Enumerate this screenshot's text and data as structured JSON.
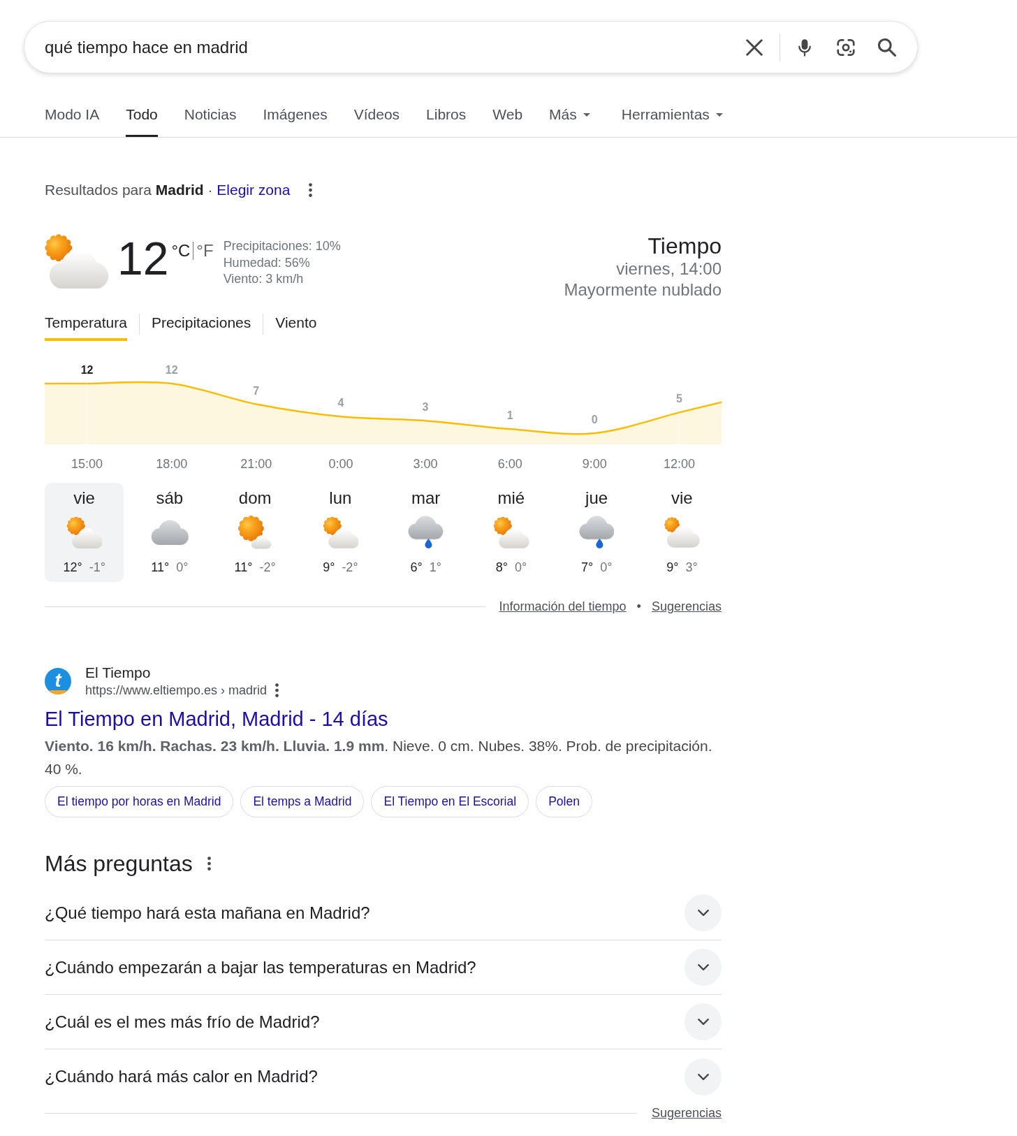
{
  "search": {
    "value": "qué tiempo hace en madrid"
  },
  "tabs": [
    {
      "label": "Modo IA",
      "kind": "link",
      "selected": false
    },
    {
      "label": "Todo",
      "kind": "link",
      "selected": true
    },
    {
      "label": "Noticias",
      "kind": "link",
      "selected": false
    },
    {
      "label": "Imágenes",
      "kind": "link",
      "selected": false
    },
    {
      "label": "Vídeos",
      "kind": "link",
      "selected": false
    },
    {
      "label": "Libros",
      "kind": "link",
      "selected": false
    },
    {
      "label": "Web",
      "kind": "link",
      "selected": false
    },
    {
      "label": "Más",
      "kind": "menu",
      "selected": false
    },
    {
      "label": "Herramientas",
      "kind": "tools",
      "selected": false
    }
  ],
  "location": {
    "text": "Resultados para **Madrid** ·",
    "link": "Elegir zona"
  },
  "weather": {
    "icon": {
      "kind": "mostly_cloudy"
    },
    "temperature": "12",
    "units": [
      {
        "label": "°C",
        "selected": true
      },
      {
        "label": "°F",
        "selected": false
      }
    ],
    "details": [
      "Precipitaciones: 10%",
      "Humedad: 56%",
      "Viento: 3 km/h"
    ],
    "title": "Tiempo",
    "datetime": "viernes, 14:00",
    "description": "Mayormente nublado",
    "chart_tabs": [
      {
        "label": "Temperatura",
        "selected": true
      },
      {
        "label": "Precipitaciones",
        "selected": false
      },
      {
        "label": "Viento",
        "selected": false
      }
    ],
    "chart": {
      "chart_data": {
        "type": "area",
        "categories": [
          "15:00",
          "18:00",
          "21:00",
          "0:00",
          "3:00",
          "6:00",
          "9:00",
          "12:00"
        ],
        "values": [
          12,
          12,
          7,
          4,
          3,
          1,
          0,
          5
        ],
        "data_labels": true
      },
      "points": [
        {
          "selected": true
        },
        {
          "selected": false
        },
        {
          "selected": false
        },
        {
          "selected": false
        },
        {
          "selected": false
        },
        {
          "selected": false
        },
        {
          "selected": false
        },
        {
          "selected": false
        }
      ]
    },
    "days": [
      {
        "day": "vie",
        "kind": "partly_cloudy",
        "high": "12°",
        "low": "-1°",
        "selected": true
      },
      {
        "day": "sáb",
        "kind": "cloudy",
        "high": "11°",
        "low": "0°",
        "selected": false
      },
      {
        "day": "dom",
        "kind": "mostly_sunny",
        "high": "11°",
        "low": "-2°",
        "selected": false
      },
      {
        "day": "lun",
        "kind": "partly_cloudy",
        "high": "9°",
        "low": "-2°",
        "selected": false
      },
      {
        "day": "mar",
        "kind": "rain",
        "high": "6°",
        "low": "1°",
        "selected": false
      },
      {
        "day": "mié",
        "kind": "partly_cloudy",
        "high": "8°",
        "low": "0°",
        "selected": false
      },
      {
        "day": "jue",
        "kind": "rain",
        "high": "7°",
        "low": "0°",
        "selected": false
      },
      {
        "day": "vie",
        "kind": "mostly_cloudy",
        "high": "9°",
        "low": "3°",
        "selected": false
      }
    ],
    "footer": {
      "links": [
        "Información del tiempo",
        "Sugerencias"
      ],
      "separator": "•"
    }
  },
  "result": {
    "logo": "t",
    "site_name": "El Tiempo",
    "url": "https://www.eltiempo.es › madrid",
    "title": "El Tiempo en Madrid, Madrid - 14 días",
    "snippet": "**Viento. 16 km/h. Rachas. 23 km/h. Lluvia. 1.9 mm**. Nieve. 0 cm. Nubes. 38%. Prob. de precipitación. 40 %.",
    "chips": [
      "El tiempo por horas en Madrid",
      "El temps a Madrid",
      "El Tiempo en El Escorial",
      "Polen"
    ]
  },
  "related_questions": {
    "title": "Más preguntas",
    "questions": [
      {
        "text": "¿Qué tiempo hará esta mañana en Madrid?",
        "expanded": false
      },
      {
        "text": "¿Cuándo empezarán a bajar las temperaturas en Madrid?",
        "expanded": false
      },
      {
        "text": "¿Cuál es el mes más frío de Madrid?",
        "expanded": false
      },
      {
        "text": "¿Cuándo hará más calor en Madrid?",
        "expanded": false
      }
    ],
    "footer_link": "Sugerencias"
  }
}
